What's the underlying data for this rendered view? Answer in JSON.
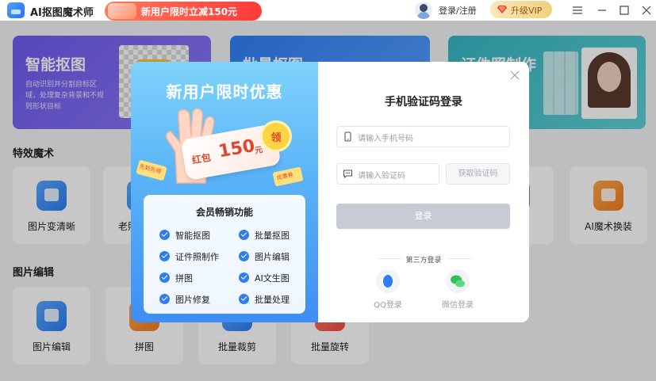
{
  "app": {
    "title": "AI抠图魔术师",
    "promo_banner": "新用户限时立减150元"
  },
  "header": {
    "login_label": "登录/注册",
    "vip_label": "升级VIP"
  },
  "banners": [
    {
      "title": "智能抠图",
      "desc": "自动识别并分割目标区域，处理复杂背景和不规则形状目标"
    },
    {
      "title": "批量抠图"
    },
    {
      "title": "证件照制作"
    }
  ],
  "sections": {
    "effects_title": "特效魔术",
    "edit_title": "图片编辑"
  },
  "effects_tools": [
    {
      "label": "图片变清晰",
      "icon": "photo-enhance-icon"
    },
    {
      "label": "老照片修复",
      "icon": "old-photo-icon"
    },
    {
      "label": "AI魔术换装",
      "icon": "outfit-swap-icon"
    }
  ],
  "edit_tools": [
    {
      "label": "图片编辑",
      "icon": "image-edit-icon"
    },
    {
      "label": "拼图",
      "icon": "collage-icon"
    },
    {
      "label": "批量裁剪",
      "icon": "batch-crop-icon"
    },
    {
      "label": "批量旋转",
      "icon": "batch-rotate-icon"
    }
  ],
  "partial_label": "图",
  "modal": {
    "promo": {
      "title": "新用户限时优惠",
      "voucher_label": "红包",
      "voucher_amount": "150",
      "voucher_unit": "元",
      "claim_label": "领",
      "ticket_left": "先到先得",
      "ticket_right": "优惠券",
      "features_title": "会员畅销功能",
      "features": [
        "智能抠图",
        "批量抠图",
        "证件照制作",
        "图片编辑",
        "拼图",
        "AI文生图",
        "图片修复",
        "批量处理"
      ]
    },
    "login": {
      "title": "手机验证码登录",
      "phone_placeholder": "请输入手机号码",
      "code_placeholder": "请输入验证码",
      "get_code": "获取验证码",
      "login_button": "登录",
      "third_party": "第三方登录",
      "qq_label": "QQ登录",
      "wechat_label": "微信登录"
    }
  },
  "colors": {
    "accent": "#2f7df2",
    "vip": "#f2cf7f",
    "promo_red": "#e0462f"
  }
}
